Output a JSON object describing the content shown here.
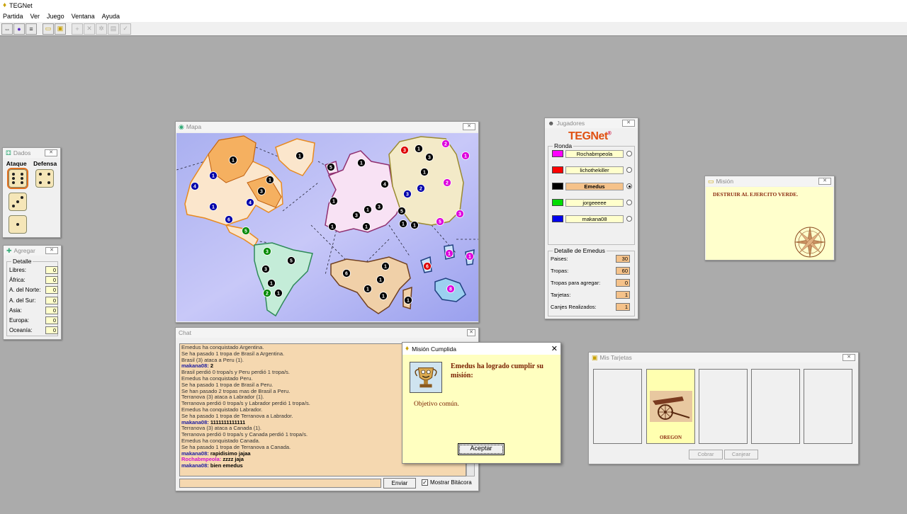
{
  "app": {
    "title": "TEGNet"
  },
  "menu": [
    "Partida",
    "Ver",
    "Juego",
    "Ventana",
    "Ayuda"
  ],
  "toolbar": {
    "icons": [
      "connect-icon",
      "start-icon",
      "list-icon",
      "card-icon",
      "mission-icon",
      "add-icon",
      "attack-icon",
      "regroup-icon",
      "cards-icon",
      "end-turn-icon"
    ]
  },
  "dados": {
    "title": "Dados",
    "attack_label": "Ataque",
    "defense_label": "Defensa",
    "attack_dice": [
      6,
      3,
      1
    ],
    "defense_dice": [
      4
    ]
  },
  "agregar": {
    "title": "Agregar",
    "group_label": "Detalle",
    "rows": [
      {
        "label": "Libres:",
        "value": "0"
      },
      {
        "label": "África:",
        "value": "0"
      },
      {
        "label": "A. del Norte:",
        "value": "0"
      },
      {
        "label": "A. del Sur:",
        "value": "0"
      },
      {
        "label": "Asia:",
        "value": "0"
      },
      {
        "label": "Europa:",
        "value": "0"
      },
      {
        "label": "Oceanía:",
        "value": "0"
      }
    ]
  },
  "mapa": {
    "title": "Mapa"
  },
  "chat": {
    "title": "Chat",
    "lines": [
      {
        "text": "Emedus ha conquistado Argentina.",
        "style": "plain"
      },
      {
        "text": "Se ha pasado 1 tropa de Brasil a Argentina.",
        "style": "plain"
      },
      {
        "text": "Brasil (3) ataca a Peru (1).",
        "style": "plain"
      },
      {
        "text": "makana08: ",
        "extra": "2",
        "style": "player",
        "color": "#1a1aa0"
      },
      {
        "text": "Brasil perdió 0 tropa/s y Peru perdió 1 tropa/s.",
        "style": "plain"
      },
      {
        "text": "Emedus ha conquistado Peru.",
        "style": "plain"
      },
      {
        "text": "Se ha pasado 1 tropa de Brasil a Peru.",
        "style": "plain"
      },
      {
        "text": "Se han pasado 2 tropas mas de Brasil a Peru.",
        "style": "plain"
      },
      {
        "text": "Terranova (3) ataca a Labrador (1).",
        "style": "plain"
      },
      {
        "text": "Terranova perdió 0 tropa/s y Labrador perdió 1 tropa/s.",
        "style": "plain"
      },
      {
        "text": "Emedus ha conquistado Labrador.",
        "style": "plain"
      },
      {
        "text": "Se ha pasado 1 tropa de Terranova a Labrador.",
        "style": "plain"
      },
      {
        "text": "makana08: ",
        "extra": "1111111111111",
        "style": "player",
        "color": "#1a1aa0"
      },
      {
        "text": "Terranova (3) ataca a Canada (1).",
        "style": "plain"
      },
      {
        "text": "Terranova perdió 0 tropa/s y Canada perdió 1 tropa/s.",
        "style": "plain"
      },
      {
        "text": "Emedus ha conquistado Canada.",
        "style": "plain"
      },
      {
        "text": "Se ha pasado 1 tropa de Terranova a Canada.",
        "style": "plain"
      },
      {
        "text": "makana08: ",
        "extra": "rapidisimo jajaa",
        "style": "player",
        "color": "#1a1aa0"
      },
      {
        "text": "Rochabmpeola: ",
        "extra": "zzzz jaja",
        "style": "player",
        "color": "#d010d0"
      },
      {
        "text": "makana08: ",
        "extra": "bien emedus",
        "style": "player",
        "color": "#1a1aa0"
      }
    ],
    "send_label": "Enviar",
    "bitacora_label": "Mostrar Bitácora",
    "bitacora_checked": true
  },
  "jugadores": {
    "title": "Jugadores",
    "logo": "TEGNet",
    "logo_mark": "®",
    "ronda_label": "Ronda",
    "players": [
      {
        "name": "Rochabmpeola",
        "color": "#ff00ff",
        "selected": false
      },
      {
        "name": "lichothekiller",
        "color": "#ff0000",
        "selected": false
      },
      {
        "name": "Emedus",
        "color": "#000000",
        "selected": true
      },
      {
        "name": "jorgeeeee",
        "color": "#00dd00",
        "selected": false
      },
      {
        "name": "makana08",
        "color": "#0000ee",
        "selected": false
      }
    ],
    "detalle_label": "Detalle de Emedus",
    "detalle": [
      {
        "label": "Paises:",
        "value": "30"
      },
      {
        "label": "Tropas:",
        "value": "60"
      },
      {
        "label": "Tropas para agregar:",
        "value": "0"
      },
      {
        "label": "Tarjetas:",
        "value": "1"
      },
      {
        "label": "Canjes Realizados:",
        "value": "1"
      }
    ]
  },
  "mision": {
    "title": "Misión",
    "text": "DESTRUIR AL EJERCITO VERDE."
  },
  "popup": {
    "title": "Misión Cumplida",
    "message": "Emedus ha logrado cumplir su misión:",
    "objective": "Objetivo común.",
    "accept_label": "Aceptar"
  },
  "tarjetas": {
    "title": "Mis Tarjetas",
    "cards": [
      "",
      "OREGON",
      "",
      "",
      ""
    ],
    "cobrar_label": "Cobrar",
    "canjear_label": "Canjear"
  }
}
